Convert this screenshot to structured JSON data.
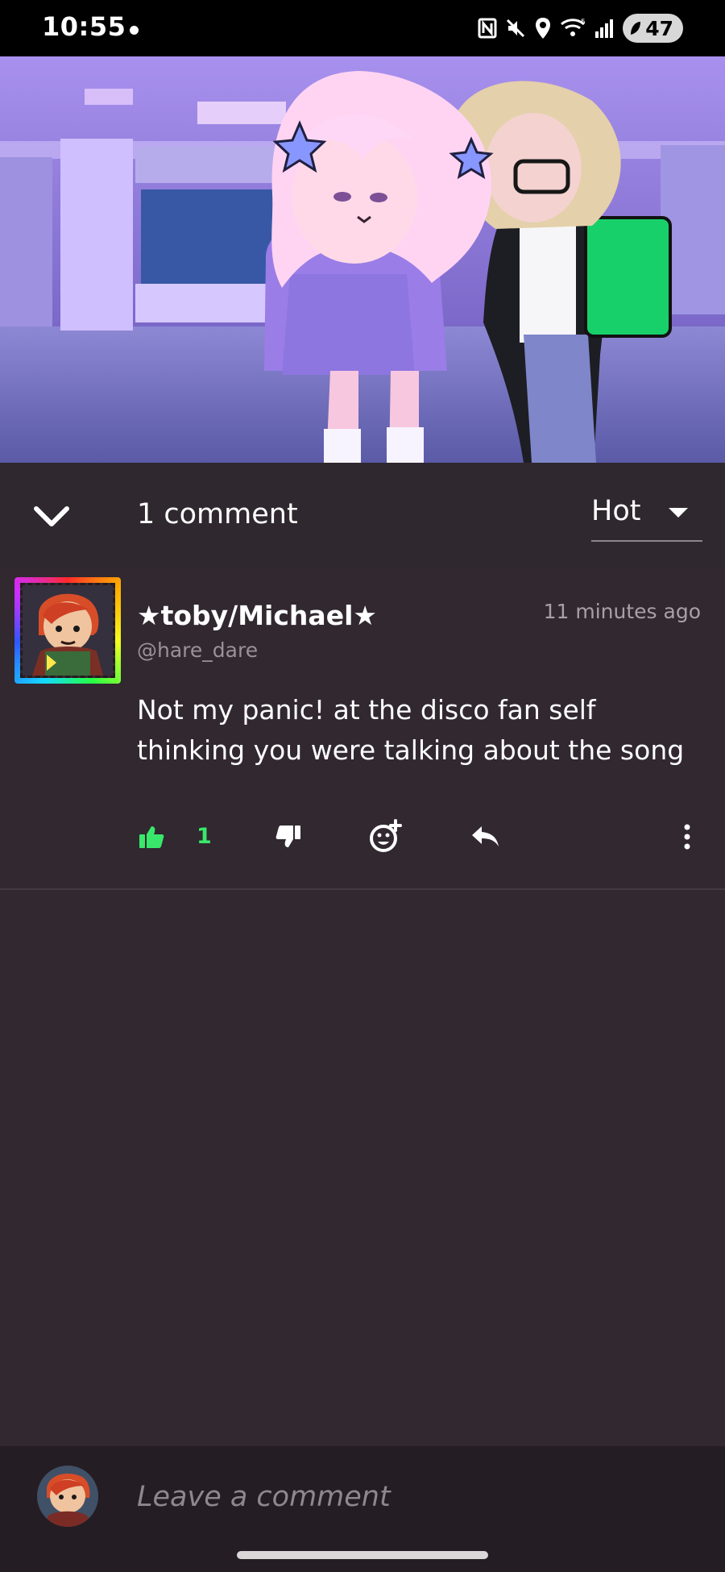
{
  "status_bar": {
    "time": "10:55",
    "battery": "47",
    "icons": [
      "nfc-icon",
      "muted-icon",
      "location-icon",
      "wifi-icon",
      "signal-icon",
      "battery-icon"
    ]
  },
  "video": {
    "scene": "animated-classroom-scene"
  },
  "comments": {
    "header": {
      "count_label": "1 comment",
      "sort_label": "Hot"
    },
    "items": [
      {
        "display_name": "★toby/Michael★",
        "handle": "@hare_dare",
        "timestamp": "11 minutes ago",
        "text": "Not my panic! at the disco fan self thinking you were talking about the song",
        "likes": "1"
      }
    ]
  },
  "composer": {
    "placeholder": "Leave a comment"
  },
  "colors": {
    "background": "#312830",
    "like_active": "#39e86b",
    "muted_text": "#a7a1a5"
  }
}
